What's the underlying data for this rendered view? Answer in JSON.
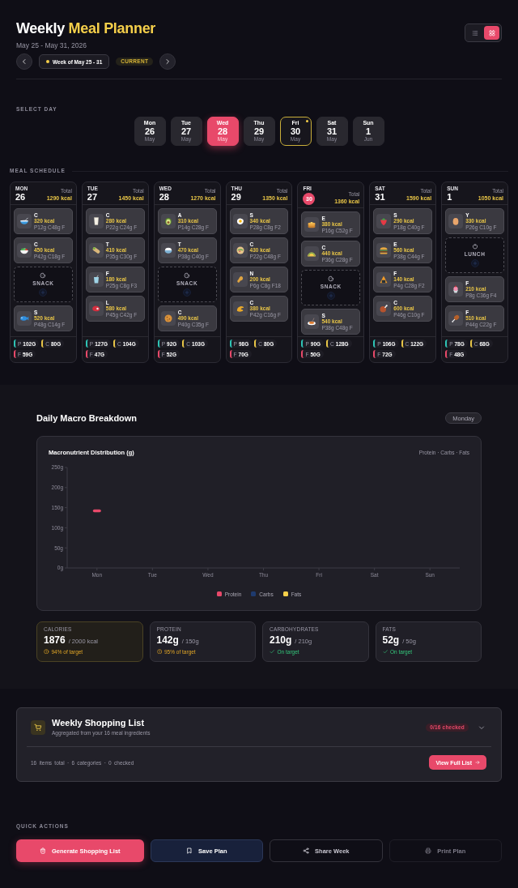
{
  "header": {
    "title": "Weekly",
    "title_highlight": "Meal Planner",
    "date_range": "May 25 - May 31, 2026",
    "week_label": "Week of May 25 - 31",
    "badge": "CURRENT",
    "views": [
      {
        "kind": "list",
        "selected": false
      },
      {
        "kind": "grid",
        "selected": true
      }
    ]
  },
  "day_selector": {
    "label": "SELECT DAY",
    "days": [
      {
        "weekday": "Mon",
        "date": "26",
        "month": "May",
        "selected": false,
        "today": false
      },
      {
        "weekday": "Tue",
        "date": "27",
        "month": "May",
        "selected": false,
        "today": false
      },
      {
        "weekday": "Wed",
        "date": "28",
        "month": "May",
        "selected": true,
        "today": false
      },
      {
        "weekday": "Thu",
        "date": "29",
        "month": "May",
        "selected": false,
        "today": false
      },
      {
        "weekday": "Fri",
        "date": "30",
        "month": "May",
        "selected": false,
        "today": true
      },
      {
        "weekday": "Sat",
        "date": "31",
        "month": "May",
        "selected": false,
        "today": false
      },
      {
        "weekday": "Sun",
        "date": "1",
        "month": "Jun",
        "selected": false,
        "today": false
      }
    ]
  },
  "meal_schedule": {
    "label": "MEAL SCHEDULE",
    "days": [
      {
        "weekday": "MON",
        "date": "26",
        "today": false,
        "total_label": "Total",
        "total": "1290 kcal",
        "meals": [
          {
            "kind": "meal",
            "name": "C",
            "calories": "320 kcal",
            "macros": "P12g C48g F"
          },
          {
            "kind": "meal",
            "name": "C",
            "calories": "450 kcal",
            "macros": "P42g C18g F"
          },
          {
            "kind": "empty",
            "label": "SNACK"
          },
          {
            "kind": "meal",
            "name": "S",
            "calories": "520 kcal",
            "macros": "P48g C14g F"
          }
        ],
        "macros": [
          {
            "label": "P",
            "value": "102G",
            "color": "#2ec4b6"
          },
          {
            "label": "C",
            "value": "80G",
            "color": "#e8c547"
          },
          {
            "label": "F",
            "value": "59G",
            "color": "#e8496a"
          }
        ]
      },
      {
        "weekday": "TUE",
        "date": "27",
        "today": false,
        "total_label": "Total",
        "total": "1450 kcal",
        "meals": [
          {
            "kind": "meal",
            "name": "C",
            "calories": "280 kcal",
            "macros": "P22g C24g F"
          },
          {
            "kind": "meal",
            "name": "T",
            "calories": "410 kcal",
            "macros": "P35g C30g F"
          },
          {
            "kind": "meal",
            "name": "F",
            "calories": "180 kcal",
            "macros": "P25g C8g F3"
          },
          {
            "kind": "meal",
            "name": "L",
            "calories": "580 kcal",
            "macros": "P45g C42g F"
          }
        ],
        "macros": [
          {
            "label": "P",
            "value": "127G",
            "color": "#2ec4b6"
          },
          {
            "label": "C",
            "value": "104G",
            "color": "#e8c547"
          },
          {
            "label": "F",
            "value": "47G",
            "color": "#e8496a"
          }
        ]
      },
      {
        "weekday": "WED",
        "date": "28",
        "today": false,
        "total_label": "Total",
        "total": "1270 kcal",
        "meals": [
          {
            "kind": "meal",
            "name": "A",
            "calories": "310 kcal",
            "macros": "P14g C28g F"
          },
          {
            "kind": "meal",
            "name": "T",
            "calories": "470 kcal",
            "macros": "P38g C40g F"
          },
          {
            "kind": "empty",
            "label": "SNACK"
          },
          {
            "kind": "meal",
            "name": "C",
            "calories": "490 kcal",
            "macros": "P40g C35g F"
          }
        ],
        "macros": [
          {
            "label": "P",
            "value": "92G",
            "color": "#2ec4b6"
          },
          {
            "label": "C",
            "value": "103G",
            "color": "#e8c547"
          },
          {
            "label": "F",
            "value": "52G",
            "color": "#e8496a"
          }
        ]
      },
      {
        "weekday": "THU",
        "date": "29",
        "today": false,
        "total_label": "Total",
        "total": "1350 kcal",
        "meals": [
          {
            "kind": "meal",
            "name": "S",
            "calories": "340 kcal",
            "macros": "P28g C8g F2"
          },
          {
            "kind": "meal",
            "name": "C",
            "calories": "430 kcal",
            "macros": "P22g C48g F"
          },
          {
            "kind": "meal",
            "name": "N",
            "calories": "200 kcal",
            "macros": "P6g C8g F18"
          },
          {
            "kind": "meal",
            "name": "C",
            "calories": "380 kcal",
            "macros": "P42g C16g F"
          }
        ],
        "macros": [
          {
            "label": "P",
            "value": "98G",
            "color": "#2ec4b6"
          },
          {
            "label": "C",
            "value": "80G",
            "color": "#e8c547"
          },
          {
            "label": "F",
            "value": "70G",
            "color": "#e8496a"
          }
        ]
      },
      {
        "weekday": "FRI",
        "date": "30",
        "today": true,
        "total_label": "Total",
        "total": "1360 kcal",
        "meals": [
          {
            "kind": "meal",
            "name": "E",
            "calories": "380 kcal",
            "macros": "P16g C52g F"
          },
          {
            "kind": "meal",
            "name": "C",
            "calories": "440 kcal",
            "macros": "P36g C28g F"
          },
          {
            "kind": "empty",
            "label": "SNACK"
          },
          {
            "kind": "meal",
            "name": "S",
            "calories": "540 kcal",
            "macros": "P38g C48g F"
          }
        ],
        "macros": [
          {
            "label": "P",
            "value": "90G",
            "color": "#2ec4b6"
          },
          {
            "label": "C",
            "value": "128G",
            "color": "#e8c547"
          },
          {
            "label": "F",
            "value": "50G",
            "color": "#e8496a"
          }
        ]
      },
      {
        "weekday": "SAT",
        "date": "31",
        "today": false,
        "total_label": "Total",
        "total": "1590 kcal",
        "meals": [
          {
            "kind": "meal",
            "name": "S",
            "calories": "290 kcal",
            "macros": "P18g C40g F"
          },
          {
            "kind": "meal",
            "name": "E",
            "calories": "560 kcal",
            "macros": "P38g C44g F"
          },
          {
            "kind": "meal",
            "name": "F",
            "calories": "140 kcal",
            "macros": "P4g C28g F2"
          },
          {
            "kind": "meal",
            "name": "C",
            "calories": "600 kcal",
            "macros": "P46g C10g F"
          }
        ],
        "macros": [
          {
            "label": "P",
            "value": "106G",
            "color": "#2ec4b6"
          },
          {
            "label": "C",
            "value": "122G",
            "color": "#e8c547"
          },
          {
            "label": "F",
            "value": "72G",
            "color": "#e8496a"
          }
        ]
      },
      {
        "weekday": "SUN",
        "date": "1",
        "today": false,
        "total_label": "Total",
        "total": "1050 kcal",
        "meals": [
          {
            "kind": "meal",
            "name": "Y",
            "calories": "330 kcal",
            "macros": "P26g C10g F"
          },
          {
            "kind": "empty",
            "label": "LUNCH"
          },
          {
            "kind": "meal",
            "name": "F",
            "calories": "210 kcal",
            "macros": "P8g C36g F4"
          },
          {
            "kind": "meal",
            "name": "F",
            "calories": "510 kcal",
            "macros": "P44g C22g F"
          }
        ],
        "macros": [
          {
            "label": "P",
            "value": "78G",
            "color": "#2ec4b6"
          },
          {
            "label": "C",
            "value": "68G",
            "color": "#e8c547"
          },
          {
            "label": "F",
            "value": "48G",
            "color": "#e8496a"
          }
        ]
      }
    ]
  },
  "macro_breakdown": {
    "title": "Daily Macro Breakdown",
    "day_badge": "Monday",
    "chart_subtitle": "Protein · Carbs · Fats",
    "chart_data": {
      "type": "line",
      "title": "Macronutrient Distribution (g)",
      "categories": [
        "Mon",
        "Tue",
        "Wed",
        "Thu",
        "Fri",
        "Sat",
        "Sun"
      ],
      "series": [
        {
          "name": "Protein",
          "color": "#e8496a",
          "marker": "square",
          "values": [
            142,
            null,
            null,
            null,
            null,
            null,
            null
          ]
        },
        {
          "name": "Carbs",
          "color": "#1e3a6e",
          "values": [
            null,
            null,
            null,
            null,
            null,
            null,
            null
          ]
        },
        {
          "name": "Fats",
          "color": "#f5cf4a",
          "values": [
            null,
            null,
            null,
            null,
            null,
            null,
            null
          ]
        }
      ],
      "ylim": [
        0,
        250
      ],
      "yticks": [
        {
          "value": 0,
          "label": "0g"
        },
        {
          "value": 50,
          "label": "50g"
        },
        {
          "value": 100,
          "label": "100g"
        },
        {
          "value": 150,
          "label": "150g"
        },
        {
          "value": 200,
          "label": "200g"
        },
        {
          "value": 250,
          "label": "250g"
        }
      ]
    },
    "stats": [
      {
        "label": "CALORIES",
        "value": "1876",
        "target": "/ 2000 kcal",
        "kind": "warning",
        "status": "94% of target",
        "highlighted": true
      },
      {
        "label": "PROTEIN",
        "value": "142g",
        "target": "/ 150g",
        "kind": "warning",
        "status": "95% of target",
        "highlighted": false
      },
      {
        "label": "CARBOHYDRATES",
        "value": "210g",
        "target": "/ 210g",
        "kind": "ok",
        "status": "On target",
        "highlighted": false
      },
      {
        "label": "FATS",
        "value": "52g",
        "target": "/ 50g",
        "kind": "ok",
        "status": "On target",
        "highlighted": false
      }
    ]
  },
  "shopping_list": {
    "title": "Weekly Shopping List",
    "subtitle": "Aggregated from your 16 meal ingredients",
    "badge": "0/16 checked",
    "expanded": false,
    "summary": "16 items total · 6 categories · 0 checked",
    "button": "View Full List"
  },
  "quick_actions": {
    "label": "QUICK ACTIONS",
    "buttons": [
      {
        "kind": "primary",
        "label": "Generate Shopping List"
      },
      {
        "kind": "secondary",
        "label": "Save Plan"
      },
      {
        "kind": "outline",
        "label": "Share Week"
      },
      {
        "kind": "ghost",
        "label": "Print Plan"
      }
    ]
  }
}
